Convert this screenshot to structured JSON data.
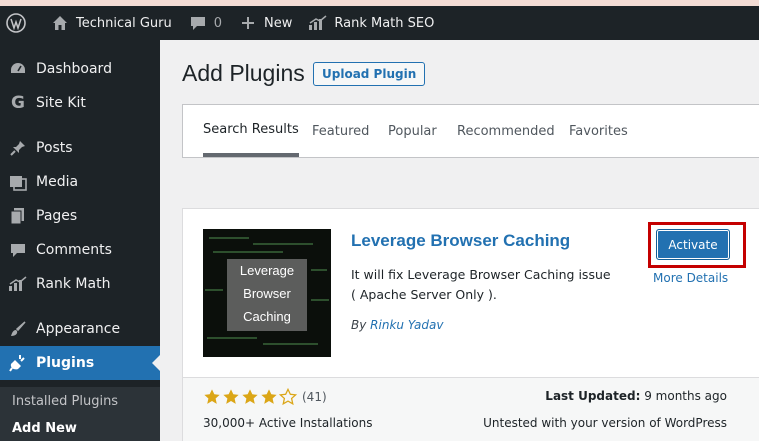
{
  "admin_bar": {
    "site_name": "Technical Guru",
    "comments_count": "0",
    "new_label": "New",
    "rank_math_label": "Rank Math SEO"
  },
  "sidebar": {
    "items": [
      {
        "label": "Dashboard",
        "icon": "dashboard-icon"
      },
      {
        "label": "Site Kit",
        "icon": "google-g-icon"
      },
      {
        "label": "Posts",
        "icon": "pin-icon"
      },
      {
        "label": "Media",
        "icon": "media-icon"
      },
      {
        "label": "Pages",
        "icon": "pages-icon"
      },
      {
        "label": "Comments",
        "icon": "comment-icon"
      },
      {
        "label": "Rank Math",
        "icon": "rank-math-icon"
      },
      {
        "label": "Appearance",
        "icon": "brush-icon"
      },
      {
        "label": "Plugins",
        "icon": "plug-icon"
      }
    ],
    "submenu": [
      {
        "label": "Installed Plugins"
      },
      {
        "label": "Add New"
      }
    ]
  },
  "page": {
    "title": "Add Plugins",
    "upload_button": "Upload Plugin"
  },
  "tabs": [
    {
      "label": "Search Results"
    },
    {
      "label": "Featured"
    },
    {
      "label": "Popular"
    },
    {
      "label": "Recommended"
    },
    {
      "label": "Favorites"
    }
  ],
  "plugin_card": {
    "thumbnail_text": [
      "Leverage",
      "Browser",
      "Caching"
    ],
    "name": "Leverage Browser Caching",
    "description_line1": "It will fix Leverage Browser Caching issue",
    "description_line2": "( Apache Server Only ).",
    "author_prefix": "By",
    "author_name": "Rinku Yadav",
    "activate_label": "Activate",
    "more_details_label": "More Details",
    "rating_stars": 4,
    "rating_count": "(41)",
    "installs": "30,000+ Active Installations",
    "last_updated_label": "Last Updated:",
    "last_updated_value": "9 months ago",
    "compatibility": "Untested with your version of WordPress"
  },
  "colors": {
    "admin_bar_bg": "#1d2327",
    "accent": "#2271b1",
    "highlight_frame": "#c40000",
    "star": "#dba617"
  }
}
